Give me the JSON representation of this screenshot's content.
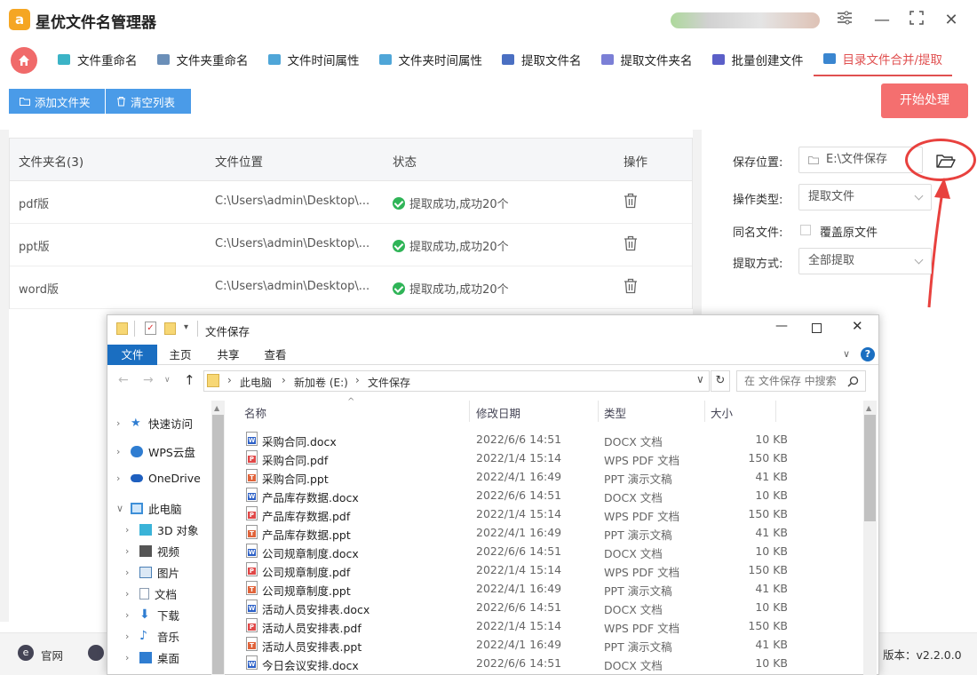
{
  "app": {
    "title": "星优文件名管理器",
    "logo_letter": "a"
  },
  "tabs": [
    {
      "label": "文件重命名",
      "color": "#3bb3c6"
    },
    {
      "label": "文件夹重命名",
      "color": "#6b8fb8"
    },
    {
      "label": "文件时间属性",
      "color": "#4fa6d8"
    },
    {
      "label": "文件夹时间属性",
      "color": "#4fa6d8"
    },
    {
      "label": "提取文件名",
      "color": "#4a6fc2"
    },
    {
      "label": "提取文件夹名",
      "color": "#7b7fd6"
    },
    {
      "label": "批量创建文件",
      "color": "#5b5fc8"
    },
    {
      "label": "目录文件合并/提取",
      "color": "#3a86d0"
    }
  ],
  "toolbar": {
    "add_folder": "添加文件夹",
    "clear_list": "清空列表",
    "start": "开始处理"
  },
  "table": {
    "headers": [
      "文件夹名(3)",
      "文件位置",
      "状态",
      "操作"
    ],
    "rows": [
      {
        "name": "pdf版",
        "path": "C:\\Users\\admin\\Desktop\\...",
        "status": "提取成功,成功20个"
      },
      {
        "name": "ppt版",
        "path": "C:\\Users\\admin\\Desktop\\...",
        "status": "提取成功,成功20个"
      },
      {
        "name": "word版",
        "path": "C:\\Users\\admin\\Desktop\\...",
        "status": "提取成功,成功20个"
      }
    ]
  },
  "settings": {
    "save_label": "保存位置:",
    "save_value": "E:\\文件保存",
    "op_label": "操作类型:",
    "op_value": "提取文件",
    "same_label": "同名文件:",
    "same_option": "覆盖原文件",
    "method_label": "提取方式:",
    "method_value": "全部提取"
  },
  "footer": {
    "website": "官网",
    "version": "版本：v2.2.0.0"
  },
  "explorer": {
    "title": "文件保存",
    "ribbon": [
      "文件",
      "主页",
      "共享",
      "查看"
    ],
    "breadcrumb": [
      "此电脑",
      "新加卷 (E:)",
      "文件保存"
    ],
    "search_placeholder": "在 文件保存 中搜索",
    "nav": [
      {
        "label": "快速访问",
        "icon": "star-icon",
        "color": "#2f7dd1",
        "indent": 0
      },
      {
        "label": "WPS云盘",
        "icon": "cloud-icon",
        "color": "#2f7dd1",
        "indent": 0
      },
      {
        "label": "OneDrive",
        "icon": "onedrive-icon",
        "color": "#1e5fbf",
        "indent": 0
      },
      {
        "label": "此电脑",
        "icon": "computer-icon",
        "color": "#3d8fd8",
        "indent": 0
      },
      {
        "label": "3D 对象",
        "icon": "cube-icon",
        "color": "#3ab3d8",
        "indent": 1
      },
      {
        "label": "视频",
        "icon": "video-icon",
        "color": "#555555",
        "indent": 1
      },
      {
        "label": "图片",
        "icon": "picture-icon",
        "color": "#4a7fb5",
        "indent": 1
      },
      {
        "label": "文档",
        "icon": "document-icon",
        "color": "#8a9bb0",
        "indent": 1
      },
      {
        "label": "下载",
        "icon": "download-icon",
        "color": "#2f7dd1",
        "indent": 1
      },
      {
        "label": "音乐",
        "icon": "music-icon",
        "color": "#2f7dd1",
        "indent": 1
      },
      {
        "label": "桌面",
        "icon": "desktop-icon",
        "color": "#2f7dd1",
        "indent": 1
      }
    ],
    "columns": [
      "名称",
      "修改日期",
      "类型",
      "大小"
    ],
    "files": [
      {
        "name": "采购合同.docx",
        "date": "2022/6/6 14:51",
        "type": "DOCX 文档",
        "size": "10 KB",
        "kind": "W"
      },
      {
        "name": "采购合同.pdf",
        "date": "2022/1/4 15:14",
        "type": "WPS PDF 文档",
        "size": "150 KB",
        "kind": "P"
      },
      {
        "name": "采购合同.ppt",
        "date": "2022/4/1 16:49",
        "type": "PPT 演示文稿",
        "size": "41 KB",
        "kind": "T"
      },
      {
        "name": "产品库存数据.docx",
        "date": "2022/6/6 14:51",
        "type": "DOCX 文档",
        "size": "10 KB",
        "kind": "W"
      },
      {
        "name": "产品库存数据.pdf",
        "date": "2022/1/4 15:14",
        "type": "WPS PDF 文档",
        "size": "150 KB",
        "kind": "P"
      },
      {
        "name": "产品库存数据.ppt",
        "date": "2022/4/1 16:49",
        "type": "PPT 演示文稿",
        "size": "41 KB",
        "kind": "T"
      },
      {
        "name": "公司规章制度.docx",
        "date": "2022/6/6 14:51",
        "type": "DOCX 文档",
        "size": "10 KB",
        "kind": "W"
      },
      {
        "name": "公司规章制度.pdf",
        "date": "2022/1/4 15:14",
        "type": "WPS PDF 文档",
        "size": "150 KB",
        "kind": "P"
      },
      {
        "name": "公司规章制度.ppt",
        "date": "2022/4/1 16:49",
        "type": "PPT 演示文稿",
        "size": "41 KB",
        "kind": "T"
      },
      {
        "name": "活动人员安排表.docx",
        "date": "2022/6/6 14:51",
        "type": "DOCX 文档",
        "size": "10 KB",
        "kind": "W"
      },
      {
        "name": "活动人员安排表.pdf",
        "date": "2022/1/4 15:14",
        "type": "WPS PDF 文档",
        "size": "150 KB",
        "kind": "P"
      },
      {
        "name": "活动人员安排表.ppt",
        "date": "2022/4/1 16:49",
        "type": "PPT 演示文稿",
        "size": "41 KB",
        "kind": "T"
      },
      {
        "name": "今日会议安排.docx",
        "date": "2022/6/6 14:51",
        "type": "DOCX 文档",
        "size": "10 KB",
        "kind": "W"
      }
    ]
  },
  "colors": {
    "accent_red": "#f46f6f",
    "button_blue": "#4a9be8",
    "success_green": "#2fb457",
    "annotation_red": "#e8413e"
  }
}
